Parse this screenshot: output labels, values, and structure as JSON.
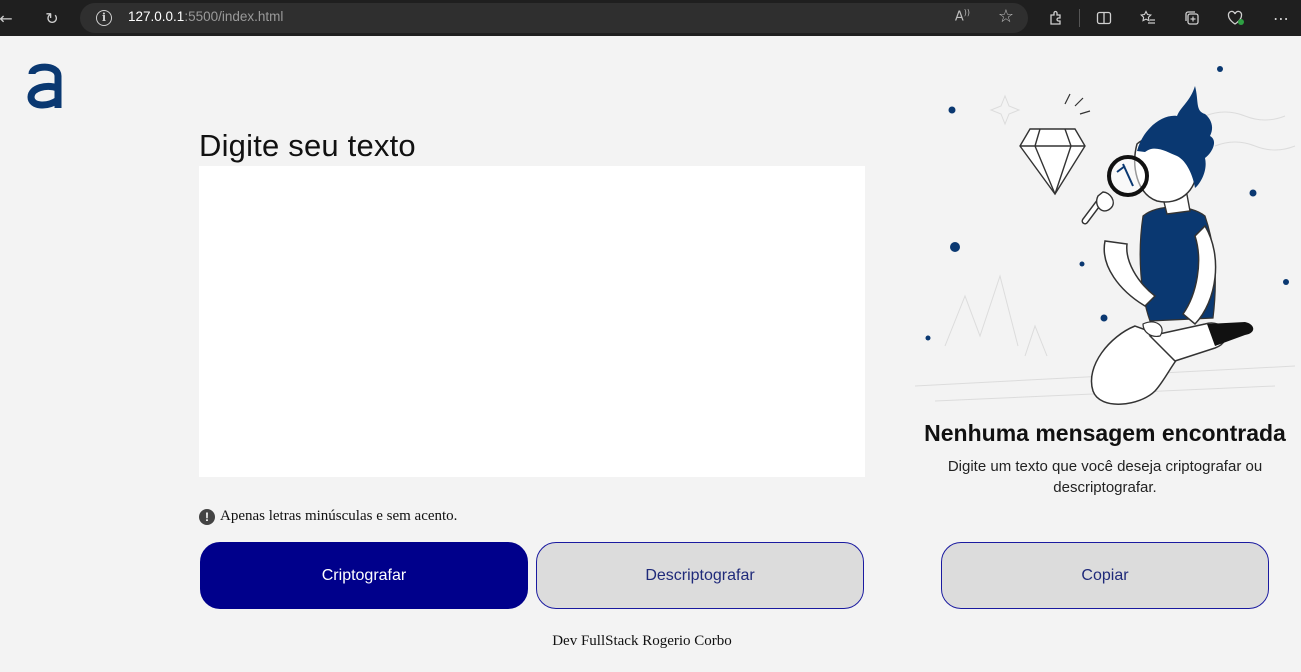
{
  "browser": {
    "url_host": "127.0.0.1",
    "url_rest": ":5500/index.html",
    "read_aloud_label": "A³"
  },
  "icons": {
    "back": "back-arrow-icon",
    "refresh": "refresh-icon",
    "info": "info-icon",
    "read_aloud": "read-aloud-icon",
    "favorite": "star-icon",
    "extensions": "puzzle-icon",
    "split_screen": "split-screen-icon",
    "favorites_bar": "favorites-icon",
    "collections": "collections-icon",
    "health": "heart-icon",
    "more": "more-icon",
    "alert": "exclamation-icon",
    "logo": "alura-logo"
  },
  "colors": {
    "primary": "#00008b",
    "background": "#f3f3f3",
    "secondary_button": "#dcdcdc",
    "illustration_accent": "#0a3871"
  },
  "main": {
    "heading": "Digite seu texto",
    "textarea_value": "",
    "hint": "Apenas letras minúsculas e sem acento.",
    "hint_icon": "!",
    "encrypt_button": "Criptografar",
    "decrypt_button": "Descriptografar"
  },
  "output": {
    "title": "Nenhuma mensagem encontrada",
    "description": "Digite um texto que você deseja criptografar ou descriptografar.",
    "copy_button": "Copiar"
  },
  "footer": {
    "text": "Dev FullStack Rogerio Corbo"
  }
}
